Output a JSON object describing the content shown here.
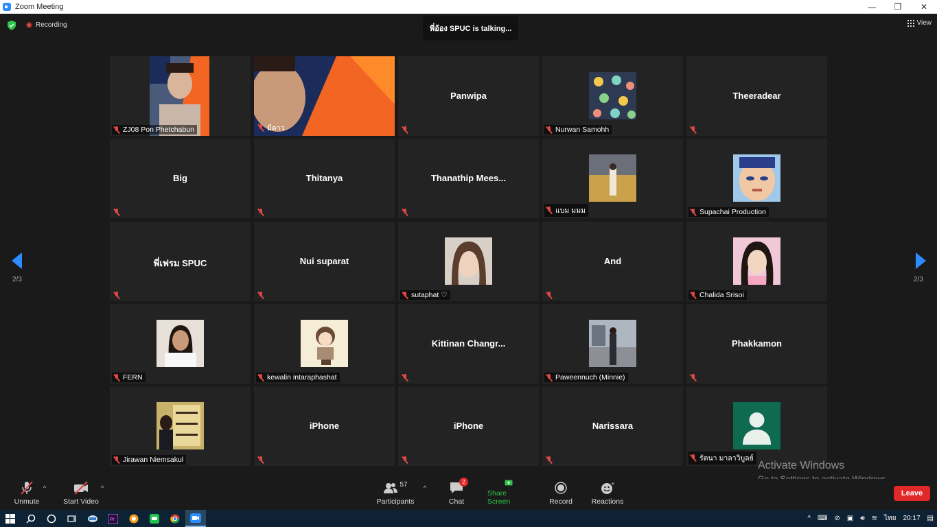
{
  "window": {
    "title": "Zoom Meeting",
    "minimize": "—",
    "maximize": "❐",
    "close": "✕"
  },
  "header": {
    "recording": "Recording",
    "talking": "พี่อ้อง SPUC is talking...",
    "view": "View"
  },
  "navigation": {
    "page": "2/3"
  },
  "participants": [
    {
      "name": "ZJ08 Pon Phetchabun",
      "has_video": true
    },
    {
      "name": "มีดาว",
      "has_video": true
    },
    {
      "name": "Panwipa",
      "display": "Panwipa"
    },
    {
      "name": "Nurwan Samohh",
      "has_avatar": true
    },
    {
      "name": "Theeradear",
      "display": "Theeradear"
    },
    {
      "name": "Big",
      "display": "Big"
    },
    {
      "name": "Thitanya",
      "display": "Thitanya"
    },
    {
      "name": "Thanathip Mees...",
      "display": "Thanathip  Mees..."
    },
    {
      "name": "แบม มมม",
      "has_avatar": true
    },
    {
      "name": "Supachai Production",
      "has_avatar": true
    },
    {
      "name": "พี่เฟรม SPUC",
      "display": "พี่เฟรม SPUC"
    },
    {
      "name": "Nui suparat",
      "display": "Nui suparat"
    },
    {
      "name": "sutaphat ♡",
      "has_avatar": true
    },
    {
      "name": "And",
      "display": "And"
    },
    {
      "name": "Chalida Srisoi",
      "has_avatar": true
    },
    {
      "name": "FERN",
      "has_avatar": true
    },
    {
      "name": "kewalin intaraphashat",
      "has_avatar": true
    },
    {
      "name": "Kittinan Changr...",
      "display": "Kittinan  Changr..."
    },
    {
      "name": "Paweennuch (Minnie)",
      "has_avatar": true
    },
    {
      "name": "Phakkamon",
      "display": "Phakkamon"
    },
    {
      "name": "Jirawan Niemsakul",
      "has_avatar": true
    },
    {
      "name": "iPhone",
      "display": "iPhone"
    },
    {
      "name": "iPhone",
      "display": "iPhone"
    },
    {
      "name": "Narissara",
      "display": "Narissara"
    },
    {
      "name": "รัตนา มาลาวิบูลย์",
      "has_avatar": true
    }
  ],
  "toolbar": {
    "unmute": "Unmute",
    "start_video": "Start Video",
    "participants": "Participants",
    "participant_count": "57",
    "chat": "Chat",
    "chat_badge": "2",
    "share_screen": "Share Screen",
    "record": "Record",
    "reactions": "Reactions",
    "leave": "Leave"
  },
  "watermark": {
    "line1": "Activate Windows",
    "line2": "Go to Settings to activate Windows."
  },
  "taskbar": {
    "language": "ไทย",
    "time": "20:17"
  },
  "colors": {
    "accent": "#2d8cff",
    "mute_red": "#e04848",
    "share_green": "#2ec44b",
    "leave_red": "#e02828"
  }
}
